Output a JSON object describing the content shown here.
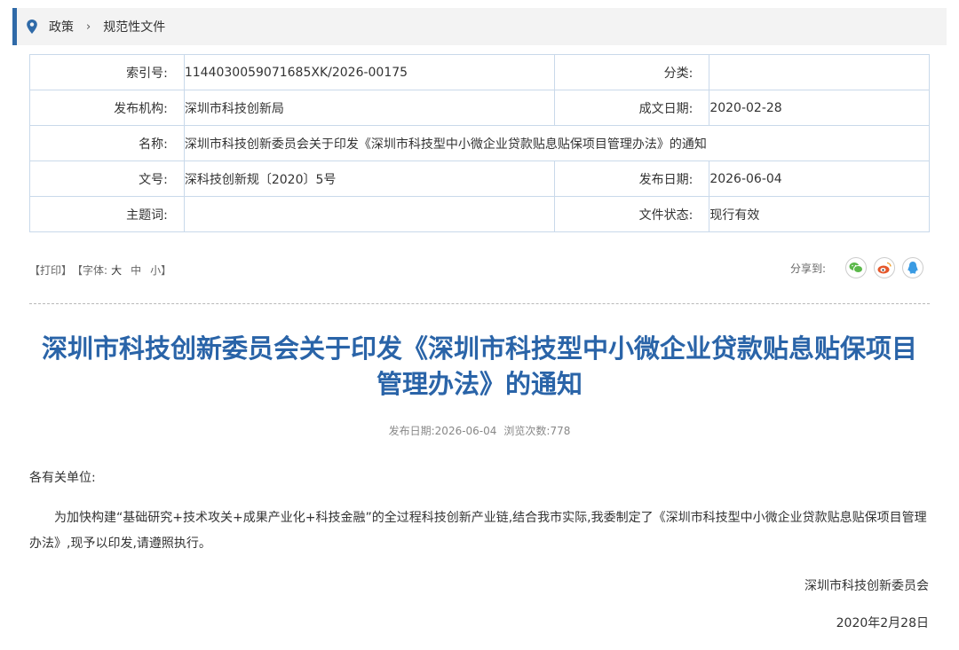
{
  "breadcrumb": {
    "items": [
      "政策",
      "规范性文件"
    ],
    "separator": "›"
  },
  "meta": {
    "index_label": "索引号:",
    "index_value": "1144030059071685XK/2026-00175",
    "category_label": "分类:",
    "category_value": "",
    "org_label": "发布机构:",
    "org_value": "深圳市科技创新局",
    "created_label": "成文日期:",
    "created_value": "2020-02-28",
    "name_label": "名称:",
    "name_value": "深圳市科技创新委员会关于印发《深圳市科技型中小微企业贷款贴息贴保项目管理办法》的通知",
    "docno_label": "文号:",
    "docno_value": "深科技创新规〔2020〕5号",
    "published_label": "发布日期:",
    "published_value": "2026-06-04",
    "subject_label": "主题词:",
    "subject_value": "",
    "status_label": "文件状态:",
    "status_value": "现行有效"
  },
  "tools": {
    "print": "【打印】",
    "font_prefix": "【字体:",
    "font_large": "大",
    "font_medium": "中",
    "font_small": "小",
    "font_suffix": "】"
  },
  "share": {
    "label": "分享到:",
    "icons": [
      "wechat-icon",
      "weibo-icon",
      "qq-icon"
    ]
  },
  "article": {
    "title": "深圳市科技创新委员会关于印发《深圳市科技型中小微企业贷款贴息贴保项目管理办法》的通知",
    "pub_date": "发布日期:2026-06-04",
    "views": "浏览次数:778",
    "greeting": "各有关单位:",
    "body": "为加快构建“基础研究+技术攻关+成果产业化+科技金融”的全过程科技创新产业链,结合我市实际,我委制定了《深圳市科技型中小微企业贷款贴息贴保项目管理办法》,现予以印发,请遵照执行。",
    "signature": "深圳市科技创新委员会",
    "date": "2020年2月28日"
  },
  "colors": {
    "accent": "#2f6aa8",
    "title": "#2a64a8",
    "border": "#c9d9ea",
    "wechat": "#5bb84a",
    "weibo": "#e5572a",
    "qq": "#3a9be3"
  }
}
